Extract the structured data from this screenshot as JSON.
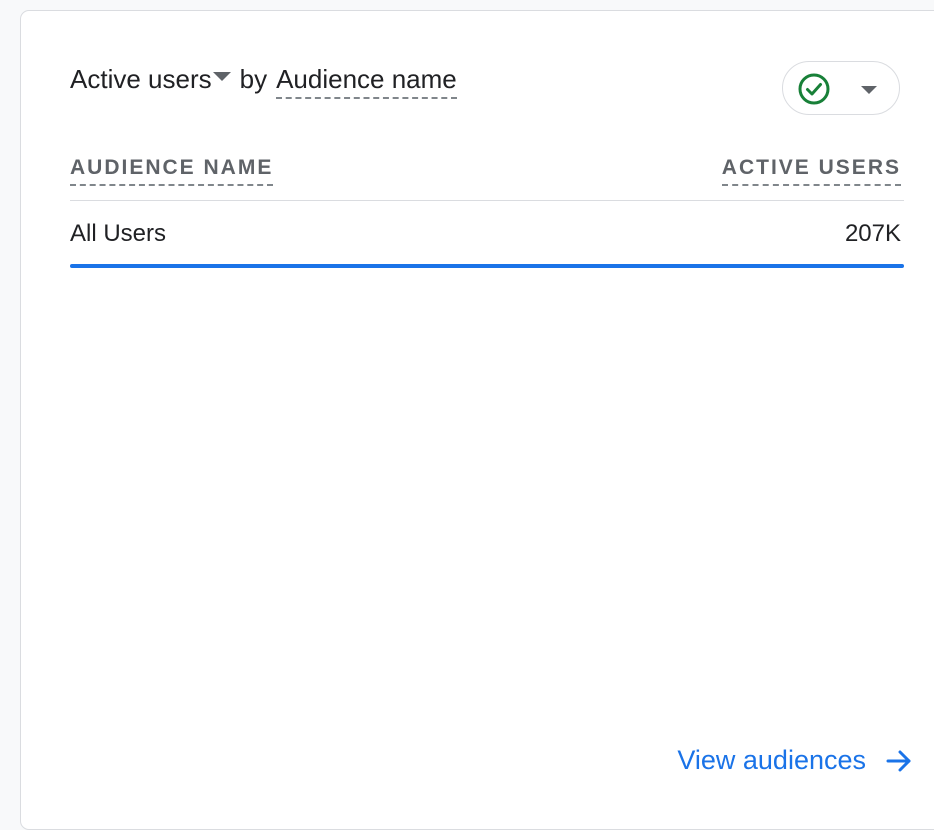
{
  "card": {
    "title": {
      "metric": "Active users",
      "connector": "by",
      "dimension": "Audience name"
    },
    "compare_button": {
      "icon": "check-circle-icon",
      "status_color": "#188038",
      "dropdown_icon": "caret-down-icon"
    },
    "table": {
      "columns": [
        "AUDIENCE NAME",
        "ACTIVE USERS"
      ],
      "rows": [
        {
          "audience_name": "All Users",
          "active_users": "207K",
          "bar_fraction": 1.0
        }
      ]
    },
    "footer": {
      "link_label": "View audiences",
      "link_icon": "arrow-right-icon"
    }
  },
  "colors": {
    "accent": "#1a73e8",
    "text_primary": "#202124",
    "text_secondary": "#5f6368",
    "border": "#dadce0"
  }
}
